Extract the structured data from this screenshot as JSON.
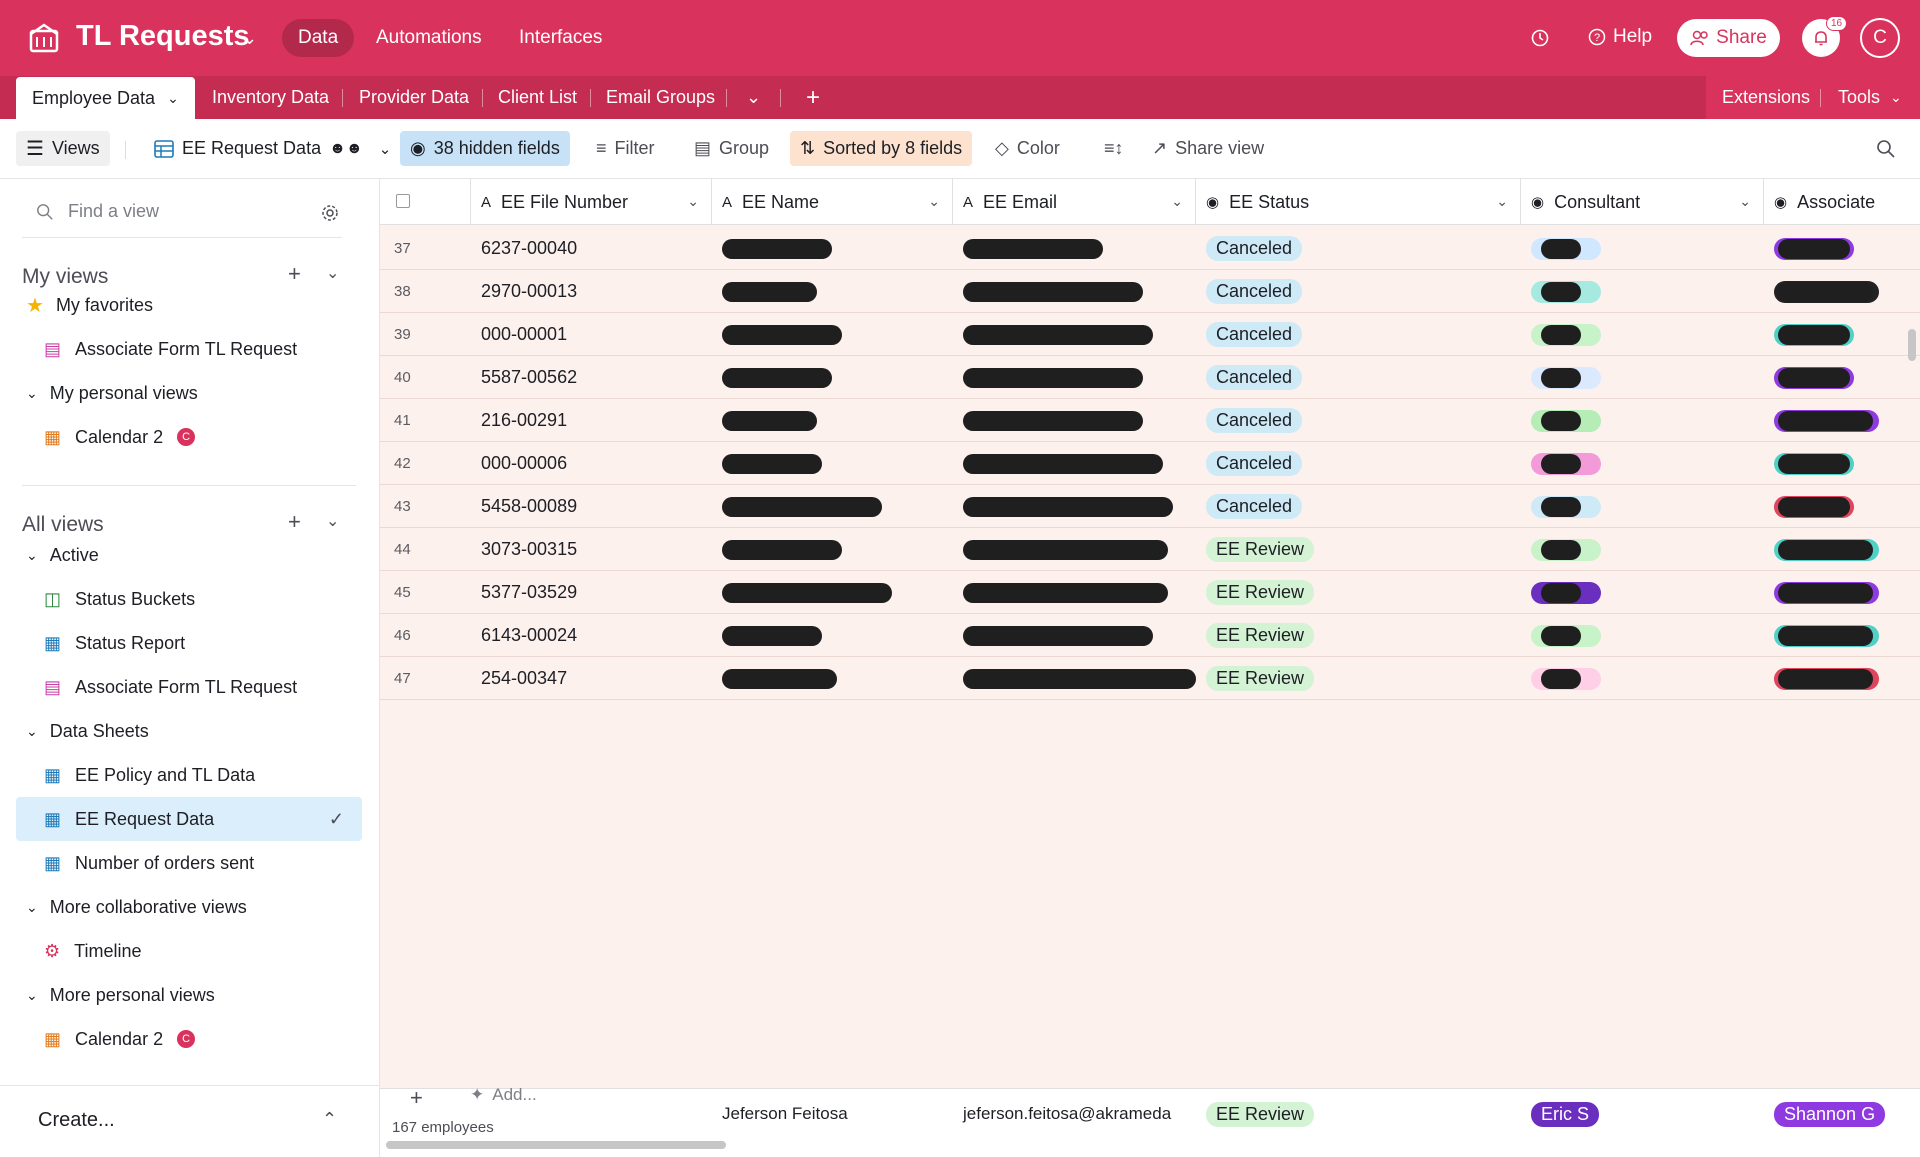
{
  "app": {
    "title": "TL Requests",
    "brand_color": "#d9335d",
    "nav": [
      "Data",
      "Automations",
      "Interfaces"
    ],
    "active_nav": "Data",
    "help_label": "Help",
    "share_label": "Share",
    "notifications_count": "16",
    "avatar_initial": "C"
  },
  "tables": {
    "tabs": [
      "Employee Data",
      "Inventory Data",
      "Provider Data",
      "Client List",
      "Email Groups"
    ],
    "active": "Employee Data",
    "extensions_label": "Extensions",
    "tools_label": "Tools"
  },
  "viewbar": {
    "views_label": "Views",
    "current_view": "EE Request Data",
    "hidden_fields": "38 hidden fields",
    "filter": "Filter",
    "group": "Group",
    "sorted": "Sorted by 8 fields",
    "color": "Color",
    "share_view": "Share view"
  },
  "sidebar": {
    "find_placeholder": "Find a view",
    "my_views": "My views",
    "my_favorites": "My favorites",
    "fav_item": "Associate Form TL Request",
    "my_personal_views": "My personal views",
    "personal_item": "Calendar 2",
    "all_views": "All views",
    "active_group": "Active",
    "active_items": [
      "Status Buckets",
      "Status Report",
      "Associate Form TL Request"
    ],
    "data_sheets": "Data Sheets",
    "data_items": [
      "EE Policy and TL Data",
      "EE Request Data",
      "Number of orders sent"
    ],
    "more_collab": "More collaborative views",
    "collab_item": "Timeline",
    "more_personal": "More personal views",
    "more_personal_item": "Calendar 2",
    "calendar_badge": "C",
    "create_label": "Create..."
  },
  "grid": {
    "columns": [
      "EE File Number",
      "EE Name",
      "EE Email",
      "EE Status",
      "Consultant",
      "Associate"
    ],
    "rows": [
      {
        "num": "37",
        "file": "6237-00040",
        "status": "Canceled"
      },
      {
        "num": "38",
        "file": "2970-00013",
        "status": "Canceled"
      },
      {
        "num": "39",
        "file": "000-00001",
        "status": "Canceled"
      },
      {
        "num": "40",
        "file": "5587-00562",
        "status": "Canceled"
      },
      {
        "num": "41",
        "file": "216-00291",
        "status": "Canceled"
      },
      {
        "num": "42",
        "file": "000-00006",
        "status": "Canceled"
      },
      {
        "num": "43",
        "file": "5458-00089",
        "status": "Canceled"
      },
      {
        "num": "44",
        "file": "3073-00315",
        "status": "EE Review"
      },
      {
        "num": "45",
        "file": "5377-03529",
        "status": "EE Review"
      },
      {
        "num": "46",
        "file": "6143-00024",
        "status": "EE Review"
      },
      {
        "num": "47",
        "file": "254-00347",
        "status": "EE Review"
      }
    ],
    "status_colors": {
      "Canceled": "#cfeaf7",
      "EE Review": "#d4f2d4"
    },
    "footer_count": "167 employees",
    "add_label": "Add...",
    "ghost_name": "Jeferson Feitosa",
    "ghost_email": "jeferson.feitosa@akrameda",
    "ghost_status": "EE Review",
    "ghost_consultant": "Eric S",
    "ghost_associate": "Shannon G"
  }
}
